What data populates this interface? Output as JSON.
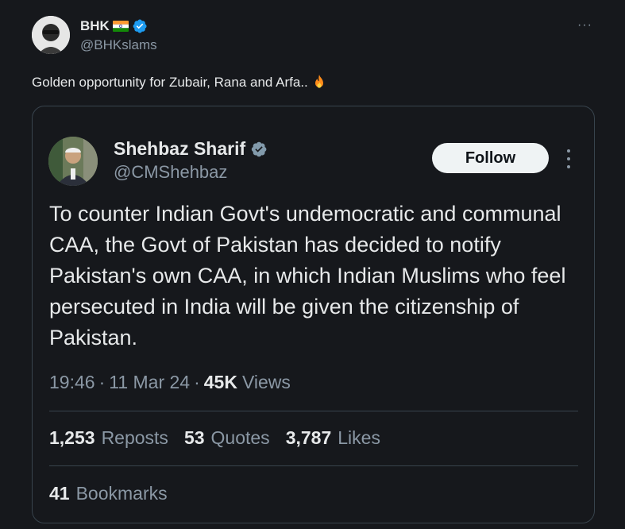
{
  "outer_tweet": {
    "display_name": "BHK",
    "handle": "@BHKslams",
    "text": "Golden opportunity for Zubair, Rana and Arfa..",
    "more_label": "···"
  },
  "quoted_tweet": {
    "display_name": "Shehbaz Sharif",
    "handle": "@CMShehbaz",
    "follow_label": "Follow",
    "text": "To counter Indian Govt's undemocratic and communal CAA, the Govt of Pakistan has decided to notify Pakistan's own CAA, in which Indian Muslims who feel persecuted in India will be given the citizenship of Pakistan.",
    "time": "19:46",
    "separator": "·",
    "date": "11 Mar 24",
    "views_count": "45K",
    "views_label": "Views",
    "stats": [
      {
        "count": "1,253",
        "label": "Reposts"
      },
      {
        "count": "53",
        "label": "Quotes"
      },
      {
        "count": "3,787",
        "label": "Likes"
      }
    ],
    "bookmarks": {
      "count": "41",
      "label": "Bookmarks"
    }
  },
  "icons": {
    "outer_verified": "verified-badge-blue",
    "inner_verified": "verified-badge-gray",
    "flag": "india-flag",
    "emoji": "fire-emoji"
  },
  "colors": {
    "background": "#16181c",
    "text_primary": "#e7e9ea",
    "text_secondary": "#8b98a5",
    "border": "#38444d",
    "verified_blue": "#1d9bf0",
    "verified_gray": "#829aab",
    "follow_bg": "#eff3f4"
  }
}
